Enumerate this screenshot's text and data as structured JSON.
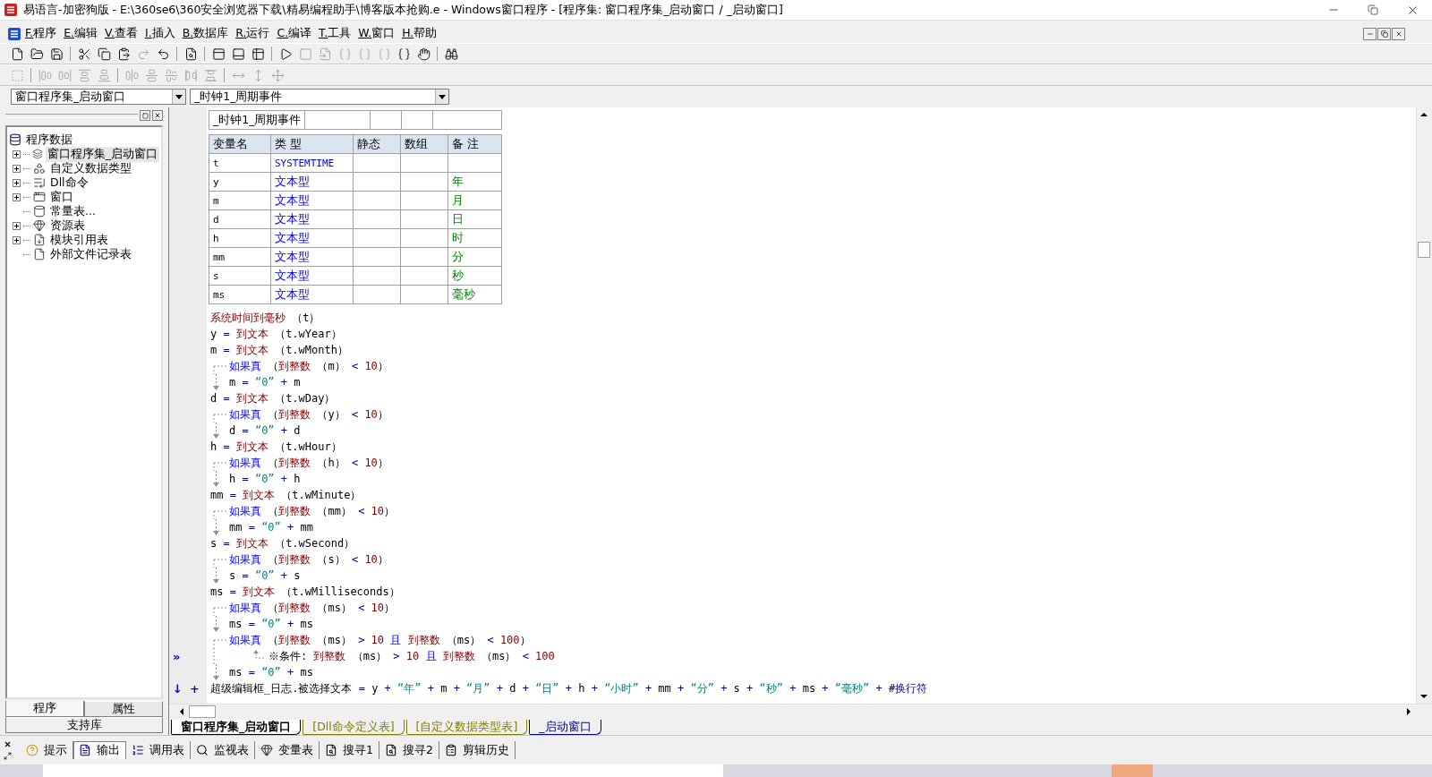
{
  "window": {
    "title": "易语言-加密狗版 - E:\\360se6\\360安全浏览器下载\\精易编程助手\\博客版本抢购.e - Windows窗口程序 - [程序集: 窗口程序集_启动窗口 / _启动窗口]"
  },
  "menu": [
    "F.程序",
    "E.编辑",
    "V.查看",
    "I.插入",
    "B.数据库",
    "R.运行",
    "C.编译",
    "T.工具",
    "W.窗口",
    "H.帮助"
  ],
  "toolbar_rows": [
    {
      "groups": [
        [
          {
            "disabled": false
          },
          {
            "disabled": false
          },
          {
            "disabled": false
          }
        ],
        [
          {
            "disabled": false
          },
          {
            "disabled": false
          },
          {
            "disabled": false
          },
          {
            "disabled": true
          },
          {
            "disabled": false
          }
        ],
        [
          {
            "disabled": false
          }
        ],
        [
          {
            "disabled": false
          },
          {
            "disabled": false
          },
          {
            "disabled": false
          }
        ],
        [
          {
            "disabled": false
          },
          {
            "disabled": true
          },
          {
            "disabled": true
          },
          {
            "disabled": true
          },
          {
            "disabled": true
          },
          {
            "disabled": true
          },
          {
            "disabled": false
          },
          {
            "disabled": false
          }
        ],
        [
          {
            "disabled": false
          }
        ]
      ]
    },
    {
      "groups": [
        [
          {
            "disabled": true
          }
        ],
        [
          {
            "disabled": true
          },
          {
            "disabled": true
          },
          {
            "disabled": true
          },
          {
            "disabled": true
          }
        ],
        [
          {
            "disabled": true
          },
          {
            "disabled": true
          },
          {
            "disabled": true
          },
          {
            "disabled": true
          },
          {
            "disabled": true
          }
        ],
        [
          {
            "disabled": true
          },
          {
            "disabled": true
          },
          {
            "disabled": true
          }
        ]
      ]
    }
  ],
  "selectors": [
    "窗口程序集_启动窗口",
    "_时钟1_周期事件"
  ],
  "project_tree": {
    "label": "程序数据",
    "children": [
      {
        "label": "窗口程序集_启动窗口",
        "kind": "folder",
        "expanded": false,
        "selected": true
      },
      {
        "label": "自定义数据类型",
        "kind": "folder",
        "expanded": false,
        "selected": false
      },
      {
        "label": "Dll命令",
        "kind": "folder",
        "expanded": false,
        "selected": false
      },
      {
        "label": "窗口",
        "kind": "folder",
        "expanded": false,
        "selected": false
      },
      {
        "label": "常量表...",
        "kind": "leaf",
        "selected": false
      },
      {
        "label": "资源表",
        "kind": "folder",
        "expanded": false,
        "selected": false
      },
      {
        "label": "模块引用表",
        "kind": "folder",
        "expanded": false,
        "selected": false
      },
      {
        "label": "外部文件记录表",
        "kind": "leaf",
        "selected": false
      }
    ]
  },
  "left_tabs": [
    {
      "label": "程序",
      "selected": true
    },
    {
      "label": "属性",
      "selected": false
    }
  ],
  "support_library": "支持库",
  "subroutine": {
    "name": "_时钟1_周期事件"
  },
  "variables": {
    "columns": [
      "变量名",
      "类 型",
      "静态",
      "数组",
      "备 注"
    ],
    "rows": [
      {
        "name": "t",
        "type": "SYSTEMTIME",
        "note": ""
      },
      {
        "name": "y",
        "type": "文本型",
        "note": "年"
      },
      {
        "name": "m",
        "type": "文本型",
        "note": "月"
      },
      {
        "name": "d",
        "type": "文本型",
        "note": "日"
      },
      {
        "name": "h",
        "type": "文本型",
        "note": "时"
      },
      {
        "name": "mm",
        "type": "文本型",
        "note": "分"
      },
      {
        "name": "s",
        "type": "文本型",
        "note": "秒"
      },
      {
        "name": "ms",
        "type": "文本型",
        "note": "毫秒"
      }
    ]
  },
  "code": [
    {
      "kind": "stmt",
      "tokens": [
        {
          "text": "系统时间到毫秒",
          "kind": "func"
        },
        {
          "text": " （t）",
          "kind": "var"
        }
      ]
    },
    {
      "kind": "stmt",
      "tokens": [
        {
          "text": "y ",
          "kind": "var"
        },
        {
          "text": "= ",
          "kind": "operator"
        },
        {
          "text": "到文本",
          "kind": "func"
        },
        {
          "text": " （t.wYear）",
          "kind": "var"
        }
      ]
    },
    {
      "kind": "stmt",
      "tokens": [
        {
          "text": "m ",
          "kind": "var"
        },
        {
          "text": "= ",
          "kind": "operator"
        },
        {
          "text": "到文本",
          "kind": "func"
        },
        {
          "text": " （t.wMonth）",
          "kind": "var"
        }
      ]
    },
    {
      "kind": "if",
      "tokens": [
        {
          "text": "如果真 ",
          "kind": "keyword"
        },
        {
          "text": "（",
          "kind": "var"
        },
        {
          "text": "到整数",
          "kind": "func"
        },
        {
          "text": " （m） ",
          "kind": "var"
        },
        {
          "text": "< ",
          "kind": "operator"
        },
        {
          "text": "10",
          "kind": "number"
        },
        {
          "text": "）",
          "kind": "var"
        }
      ],
      "children": [
        {
          "kind": "stmt",
          "tokens": [
            {
              "text": "m ",
              "kind": "var"
            },
            {
              "text": "= ",
              "kind": "operator"
            },
            {
              "text": "“0” ",
              "kind": "string"
            },
            {
              "text": "+ ",
              "kind": "operator"
            },
            {
              "text": "m",
              "kind": "var"
            }
          ]
        }
      ]
    },
    {
      "kind": "stmt",
      "tokens": [
        {
          "text": "d ",
          "kind": "var"
        },
        {
          "text": "= ",
          "kind": "operator"
        },
        {
          "text": "到文本",
          "kind": "func"
        },
        {
          "text": " （t.wDay）",
          "kind": "var"
        }
      ]
    },
    {
      "kind": "if",
      "tokens": [
        {
          "text": "如果真 ",
          "kind": "keyword"
        },
        {
          "text": "（",
          "kind": "var"
        },
        {
          "text": "到整数",
          "kind": "func"
        },
        {
          "text": " （y） ",
          "kind": "var"
        },
        {
          "text": "< ",
          "kind": "operator"
        },
        {
          "text": "10",
          "kind": "number"
        },
        {
          "text": "）",
          "kind": "var"
        }
      ],
      "children": [
        {
          "kind": "stmt",
          "tokens": [
            {
              "text": "d ",
              "kind": "var"
            },
            {
              "text": "= ",
              "kind": "operator"
            },
            {
              "text": "“0” ",
              "kind": "string"
            },
            {
              "text": "+ ",
              "kind": "operator"
            },
            {
              "text": "d",
              "kind": "var"
            }
          ]
        }
      ]
    },
    {
      "kind": "stmt",
      "tokens": [
        {
          "text": "h ",
          "kind": "var"
        },
        {
          "text": "= ",
          "kind": "operator"
        },
        {
          "text": "到文本",
          "kind": "func"
        },
        {
          "text": " （t.wHour）",
          "kind": "var"
        }
      ]
    },
    {
      "kind": "if",
      "tokens": [
        {
          "text": "如果真 ",
          "kind": "keyword"
        },
        {
          "text": "（",
          "kind": "var"
        },
        {
          "text": "到整数",
          "kind": "func"
        },
        {
          "text": " （h） ",
          "kind": "var"
        },
        {
          "text": "< ",
          "kind": "operator"
        },
        {
          "text": "10",
          "kind": "number"
        },
        {
          "text": "）",
          "kind": "var"
        }
      ],
      "children": [
        {
          "kind": "stmt",
          "tokens": [
            {
              "text": "h ",
              "kind": "var"
            },
            {
              "text": "= ",
              "kind": "operator"
            },
            {
              "text": "“0” ",
              "kind": "string"
            },
            {
              "text": "+ ",
              "kind": "operator"
            },
            {
              "text": "h",
              "kind": "var"
            }
          ]
        }
      ]
    },
    {
      "kind": "stmt",
      "tokens": [
        {
          "text": "mm ",
          "kind": "var"
        },
        {
          "text": "= ",
          "kind": "operator"
        },
        {
          "text": "到文本",
          "kind": "func"
        },
        {
          "text": " （t.wMinute）",
          "kind": "var"
        }
      ]
    },
    {
      "kind": "if",
      "tokens": [
        {
          "text": "如果真 ",
          "kind": "keyword"
        },
        {
          "text": "（",
          "kind": "var"
        },
        {
          "text": "到整数",
          "kind": "func"
        },
        {
          "text": " （mm） ",
          "kind": "var"
        },
        {
          "text": "< ",
          "kind": "operator"
        },
        {
          "text": "10",
          "kind": "number"
        },
        {
          "text": "）",
          "kind": "var"
        }
      ],
      "children": [
        {
          "kind": "stmt",
          "tokens": [
            {
              "text": "mm ",
              "kind": "var"
            },
            {
              "text": "= ",
              "kind": "operator"
            },
            {
              "text": "“0” ",
              "kind": "string"
            },
            {
              "text": "+ ",
              "kind": "operator"
            },
            {
              "text": "mm",
              "kind": "var"
            }
          ]
        }
      ]
    },
    {
      "kind": "stmt",
      "tokens": [
        {
          "text": "s ",
          "kind": "var"
        },
        {
          "text": "= ",
          "kind": "operator"
        },
        {
          "text": "到文本",
          "kind": "func"
        },
        {
          "text": " （t.wSecond）",
          "kind": "var"
        }
      ]
    },
    {
      "kind": "if",
      "tokens": [
        {
          "text": "如果真 ",
          "kind": "keyword"
        },
        {
          "text": "（",
          "kind": "var"
        },
        {
          "text": "到整数",
          "kind": "func"
        },
        {
          "text": " （s） ",
          "kind": "var"
        },
        {
          "text": "< ",
          "kind": "operator"
        },
        {
          "text": "10",
          "kind": "number"
        },
        {
          "text": "）",
          "kind": "var"
        }
      ],
      "children": [
        {
          "kind": "stmt",
          "tokens": [
            {
              "text": "s ",
              "kind": "var"
            },
            {
              "text": "= ",
              "kind": "operator"
            },
            {
              "text": "“0” ",
              "kind": "string"
            },
            {
              "text": "+ ",
              "kind": "operator"
            },
            {
              "text": "s",
              "kind": "var"
            }
          ]
        }
      ]
    },
    {
      "kind": "stmt",
      "tokens": [
        {
          "text": "ms ",
          "kind": "var"
        },
        {
          "text": "= ",
          "kind": "operator"
        },
        {
          "text": "到文本",
          "kind": "func"
        },
        {
          "text": " （t.wMilliseconds）",
          "kind": "var"
        }
      ]
    },
    {
      "kind": "if",
      "tokens": [
        {
          "text": "如果真 ",
          "kind": "keyword"
        },
        {
          "text": "（",
          "kind": "var"
        },
        {
          "text": "到整数",
          "kind": "func"
        },
        {
          "text": " （ms） ",
          "kind": "var"
        },
        {
          "text": "< ",
          "kind": "operator"
        },
        {
          "text": "10",
          "kind": "number"
        },
        {
          "text": "）",
          "kind": "var"
        }
      ],
      "children": [
        {
          "kind": "stmt",
          "tokens": [
            {
              "text": "ms ",
              "kind": "var"
            },
            {
              "text": "= ",
              "kind": "operator"
            },
            {
              "text": "“0” ",
              "kind": "string"
            },
            {
              "text": "+ ",
              "kind": "operator"
            },
            {
              "text": "ms",
              "kind": "var"
            }
          ]
        }
      ]
    },
    {
      "kind": "if",
      "tokens": [
        {
          "text": "如果真 ",
          "kind": "keyword"
        },
        {
          "text": "（",
          "kind": "var"
        },
        {
          "text": "到整数",
          "kind": "func"
        },
        {
          "text": " （ms） ",
          "kind": "var"
        },
        {
          "text": "> ",
          "kind": "operator"
        },
        {
          "text": "10 ",
          "kind": "number"
        },
        {
          "text": "且 ",
          "kind": "keyword"
        },
        {
          "text": "到整数",
          "kind": "func"
        },
        {
          "text": " （ms） ",
          "kind": "var"
        },
        {
          "text": "< ",
          "kind": "operator"
        },
        {
          "text": "100",
          "kind": "number"
        },
        {
          "text": "）",
          "kind": "var"
        }
      ],
      "children": [
        {
          "kind": "note",
          "gutter": [
            "»"
          ],
          "tokens": [
            {
              "text": "※条件: ",
              "kind": "var"
            },
            {
              "text": "到整数",
              "kind": "func"
            },
            {
              "text": " （ms） ",
              "kind": "var"
            },
            {
              "text": "> ",
              "kind": "operator"
            },
            {
              "text": "10 ",
              "kind": "number"
            },
            {
              "text": "且 ",
              "kind": "keyword"
            },
            {
              "text": "到整数",
              "kind": "func"
            },
            {
              "text": " （ms） ",
              "kind": "var"
            },
            {
              "text": "< ",
              "kind": "operator"
            },
            {
              "text": "100",
              "kind": "number"
            }
          ]
        },
        {
          "kind": "stmt",
          "tokens": [
            {
              "text": "ms ",
              "kind": "var"
            },
            {
              "text": "= ",
              "kind": "operator"
            },
            {
              "text": "“0” ",
              "kind": "string"
            },
            {
              "text": "+ ",
              "kind": "operator"
            },
            {
              "text": "ms",
              "kind": "var"
            }
          ]
        }
      ]
    },
    {
      "kind": "stmt",
      "gutter": [
        "↓",
        "+"
      ],
      "tokens": [
        {
          "text": "超级编辑框_日志.被选择文本 ",
          "kind": "var"
        },
        {
          "text": "= ",
          "kind": "operator"
        },
        {
          "text": "y ",
          "kind": "var"
        },
        {
          "text": "+ ",
          "kind": "operator"
        },
        {
          "text": "“年” ",
          "kind": "string"
        },
        {
          "text": "+ ",
          "kind": "operator"
        },
        {
          "text": "m ",
          "kind": "var"
        },
        {
          "text": "+ ",
          "kind": "operator"
        },
        {
          "text": "“月” ",
          "kind": "string"
        },
        {
          "text": "+ ",
          "kind": "operator"
        },
        {
          "text": "d ",
          "kind": "var"
        },
        {
          "text": "+ ",
          "kind": "operator"
        },
        {
          "text": "“日” ",
          "kind": "string"
        },
        {
          "text": "+ ",
          "kind": "operator"
        },
        {
          "text": "h ",
          "kind": "var"
        },
        {
          "text": "+ ",
          "kind": "operator"
        },
        {
          "text": "“小时” ",
          "kind": "string"
        },
        {
          "text": "+ ",
          "kind": "operator"
        },
        {
          "text": "mm ",
          "kind": "var"
        },
        {
          "text": "+ ",
          "kind": "operator"
        },
        {
          "text": "“分” ",
          "kind": "string"
        },
        {
          "text": "+ ",
          "kind": "operator"
        },
        {
          "text": "s ",
          "kind": "var"
        },
        {
          "text": "+ ",
          "kind": "operator"
        },
        {
          "text": "“秒” ",
          "kind": "string"
        },
        {
          "text": "+ ",
          "kind": "operator"
        },
        {
          "text": "ms ",
          "kind": "var"
        },
        {
          "text": "+ ",
          "kind": "operator"
        },
        {
          "text": "“毫秒” ",
          "kind": "string"
        },
        {
          "text": "+ ",
          "kind": "operator"
        },
        {
          "text": "#换行符",
          "kind": "constant"
        }
      ]
    }
  ],
  "editor_tabs": [
    {
      "label": "窗口程序集_启动窗口",
      "selected": true,
      "color": "#000000"
    },
    {
      "label": "[Dll命令定义表]",
      "selected": false,
      "color": "#808000"
    },
    {
      "label": "[自定义数据类型表]",
      "selected": false,
      "color": "#808000"
    },
    {
      "label": "_启动窗口",
      "selected": false,
      "color": "#000080"
    }
  ],
  "output_tabs": [
    {
      "label": "提示",
      "selected": false
    },
    {
      "label": "输出",
      "selected": true
    },
    {
      "label": "调用表",
      "selected": false
    },
    {
      "label": "监视表",
      "selected": false
    },
    {
      "label": "变量表",
      "selected": false
    },
    {
      "label": "搜寻1",
      "selected": false
    },
    {
      "label": "搜寻2",
      "selected": false
    },
    {
      "label": "剪辑历史",
      "selected": false
    }
  ]
}
